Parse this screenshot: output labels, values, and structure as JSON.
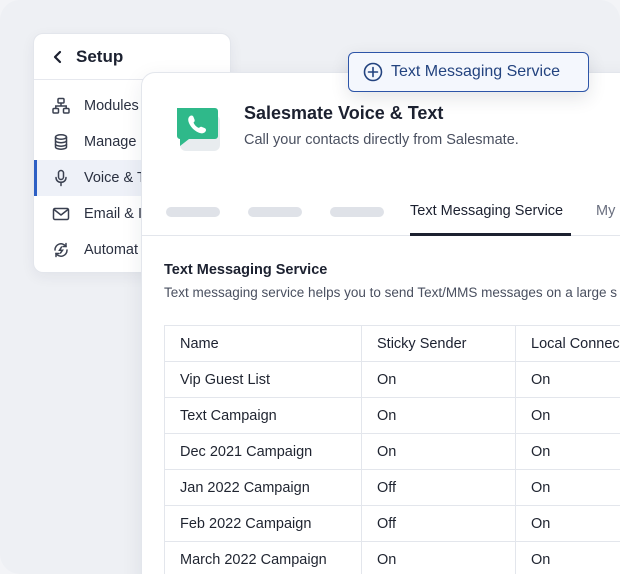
{
  "setup": {
    "title": "Setup",
    "items": [
      {
        "label": "Modules",
        "icon": "modules-icon"
      },
      {
        "label": "Manage",
        "icon": "database-icon"
      },
      {
        "label": "Voice & T",
        "icon": "microphone-icon",
        "active": true
      },
      {
        "label": "Email & I",
        "icon": "mail-icon"
      },
      {
        "label": "Automat",
        "icon": "automation-icon"
      }
    ]
  },
  "float_button": {
    "label": "Text Messaging Service",
    "icon": "plus-circle-icon"
  },
  "app": {
    "title": "Salesmate Voice & Text",
    "subtitle": "Call your contacts directly from Salesmate.",
    "logo_color": "#2fb98a"
  },
  "tabs": {
    "active": "Text Messaging Service",
    "next": "My"
  },
  "section": {
    "title": "Text Messaging Service",
    "description": "Text messaging service helps you to send Text/MMS messages on a large s"
  },
  "table": {
    "headers": [
      "Name",
      "Sticky Sender",
      "Local Connec"
    ],
    "rows": [
      [
        "Vip Guest List",
        "On",
        "On"
      ],
      [
        "Text Campaign",
        "On",
        "On"
      ],
      [
        "Dec 2021 Campaign",
        "On",
        "On"
      ],
      [
        "Jan 2022 Campaign",
        "Off",
        "On"
      ],
      [
        "Feb 2022 Campaign",
        "Off",
        "On"
      ],
      [
        "March 2022 Campaign",
        "On",
        "On"
      ]
    ]
  }
}
